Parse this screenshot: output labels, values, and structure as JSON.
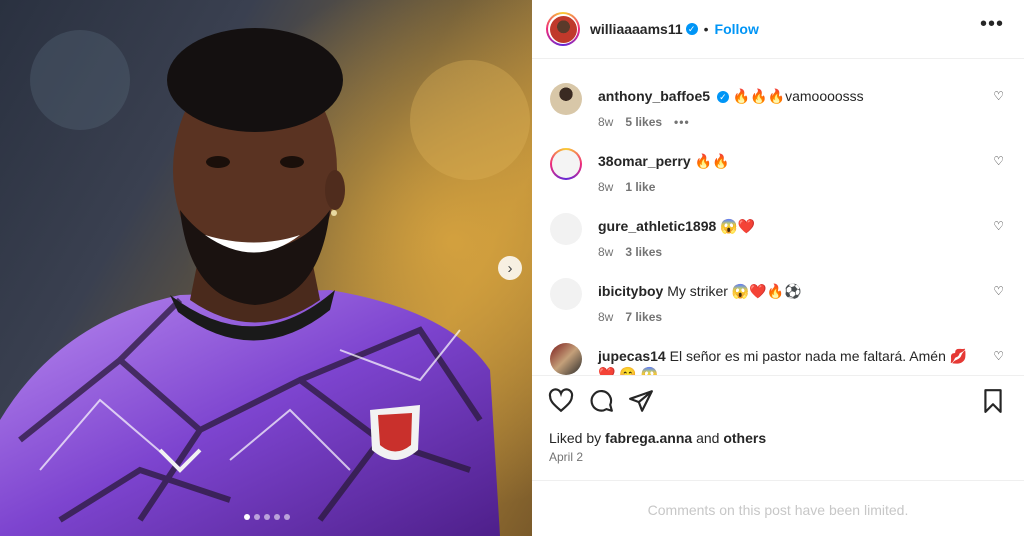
{
  "post": {
    "username": "williaaaams11",
    "separator": "•",
    "follow_label": "Follow",
    "more_label": "•••",
    "next_label": "›",
    "carousel_count": 5,
    "carousel_active": 0
  },
  "comments": [
    {
      "username": "anthony_baffoe5",
      "verified": true,
      "text": "🔥🔥🔥vamoooosss",
      "age": "8w",
      "likes": "5 likes",
      "has_more": true
    },
    {
      "username": "38omar_perry",
      "verified": false,
      "text": "🔥🔥",
      "age": "8w",
      "likes": "1 like",
      "has_more": false
    },
    {
      "username": "gure_athletic1898",
      "verified": false,
      "text": "😱❤️",
      "age": "8w",
      "likes": "3 likes",
      "has_more": false
    },
    {
      "username": "ibicityboy",
      "verified": false,
      "text": "My striker 😱❤️🔥⚽",
      "age": "8w",
      "likes": "7 likes",
      "has_more": false
    },
    {
      "username": "jupecas14",
      "verified": false,
      "text": "El señor es mi pastor nada me faltará. Amén 💋 ❤️ 😊 😱",
      "age": "",
      "likes": "",
      "has_more": false
    }
  ],
  "engagement": {
    "liked_by_prefix": "Liked by",
    "liked_by_user": "fabrega.anna",
    "liked_by_and": "and",
    "liked_by_others": "others",
    "date": "April 2"
  },
  "footer": {
    "limited_text": "Comments on this post have been limited."
  },
  "colors": {
    "accent": "#0095f6",
    "shirt_purple": "#8a4fd8",
    "text_muted": "#737373"
  }
}
